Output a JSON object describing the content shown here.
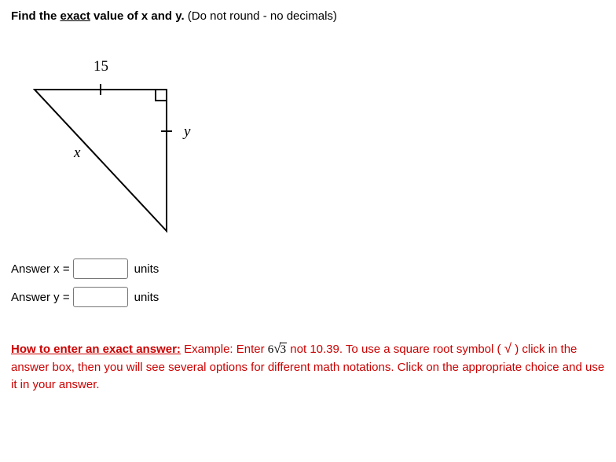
{
  "prompt": {
    "lead": "Find the ",
    "emph": "exact",
    "tail": " value of x and y.",
    "paren": " (Do not round - no decimals)"
  },
  "figure": {
    "top_label": "15",
    "hyp_label": "x",
    "right_label": "y"
  },
  "answers": {
    "x": {
      "label": "Answer x =",
      "value": "",
      "units": "units"
    },
    "y": {
      "label": "Answer y =",
      "value": "",
      "units": "units"
    }
  },
  "howto": {
    "title": "How to enter an exact answer:",
    "example_pre": "  Example: Enter ",
    "example_radicand_base": "6",
    "example_radicand": "3",
    "example_post": "  not 10.39.  To use a square root symbol ( ",
    "check": "√",
    "after_check": " ) click in the answer box, then you will see several options for different math notations.  Click on the appropriate choice and use it in your answer."
  }
}
